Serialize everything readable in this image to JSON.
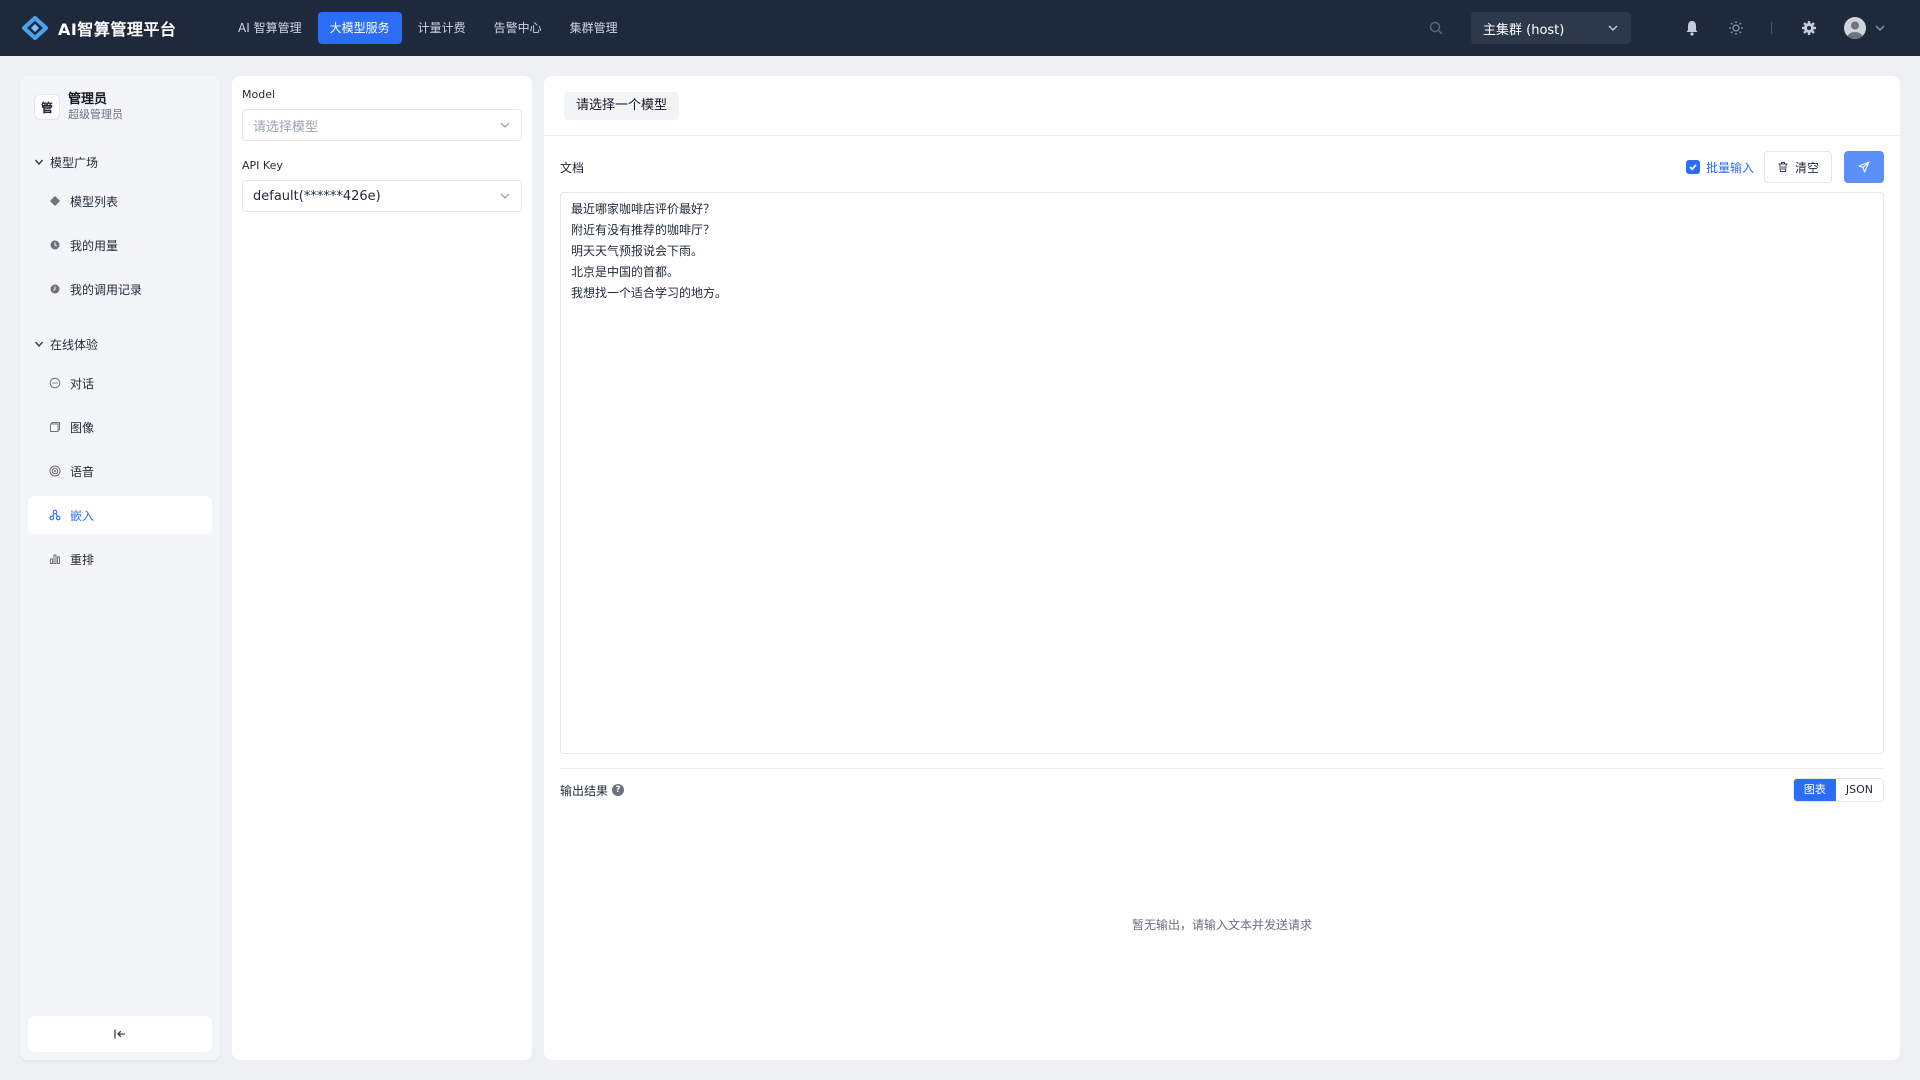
{
  "topbar": {
    "brand_title": "AI智算管理平台",
    "nav": [
      {
        "label": "AI 智算管理",
        "active": false
      },
      {
        "label": "大模型服务",
        "active": true
      },
      {
        "label": "计量计费",
        "active": false
      },
      {
        "label": "告警中心",
        "active": false
      },
      {
        "label": "集群管理",
        "active": false
      }
    ],
    "cluster_select": "主集群 (host)",
    "icons": [
      "search-icon",
      "bell-icon",
      "sun-icon",
      "gear-icon",
      "user-avatar-icon",
      "chevron-down-icon"
    ]
  },
  "sidebar": {
    "profile": {
      "avatar_text": "管",
      "name": "管理员",
      "role": "超级管理员"
    },
    "groups": [
      {
        "title": "模型广场",
        "items": [
          {
            "label": "模型列表",
            "icon": "cube-icon"
          },
          {
            "label": "我的用量",
            "icon": "clock-icon"
          },
          {
            "label": "我的调用记录",
            "icon": "history-icon"
          }
        ]
      },
      {
        "title": "在线体验",
        "items": [
          {
            "label": "对话",
            "icon": "chat-icon"
          },
          {
            "label": "图像",
            "icon": "image-icon"
          },
          {
            "label": "语音",
            "icon": "audio-icon"
          },
          {
            "label": "嵌入",
            "icon": "embed-icon",
            "active": true
          },
          {
            "label": "重排",
            "icon": "bar-chart-icon"
          }
        ]
      }
    ],
    "collapse_icon": "collapse-left-icon"
  },
  "midpanel": {
    "model_label": "Model",
    "model_placeholder": "请选择模型",
    "apikey_label": "API Key",
    "apikey_value": "default(******426e)"
  },
  "main": {
    "model_chip": "请选择一个模型",
    "doc_label": "文档",
    "batch_label": "批量输入",
    "batch_checked": true,
    "clear_label": "清空",
    "doc_lines": [
      "最近哪家咖啡店评价最好？",
      "附近有没有推荐的咖啡厅？",
      "明天天气预报说会下雨。",
      "北京是中国的首都。",
      "我想找一个适合学习的地方。"
    ],
    "output_label": "输出结果",
    "help_text": "?",
    "view_tabs": [
      {
        "label": "图表",
        "active": true
      },
      {
        "label": "JSON",
        "active": false
      }
    ],
    "empty_message": "暂无输出，请输入文本并发送请求"
  },
  "colors": {
    "topbar_bg": "#1e2a3b",
    "accent": "#2b6ef5",
    "send_button": "#5b8ff9",
    "page_bg": "#eef0f4"
  }
}
